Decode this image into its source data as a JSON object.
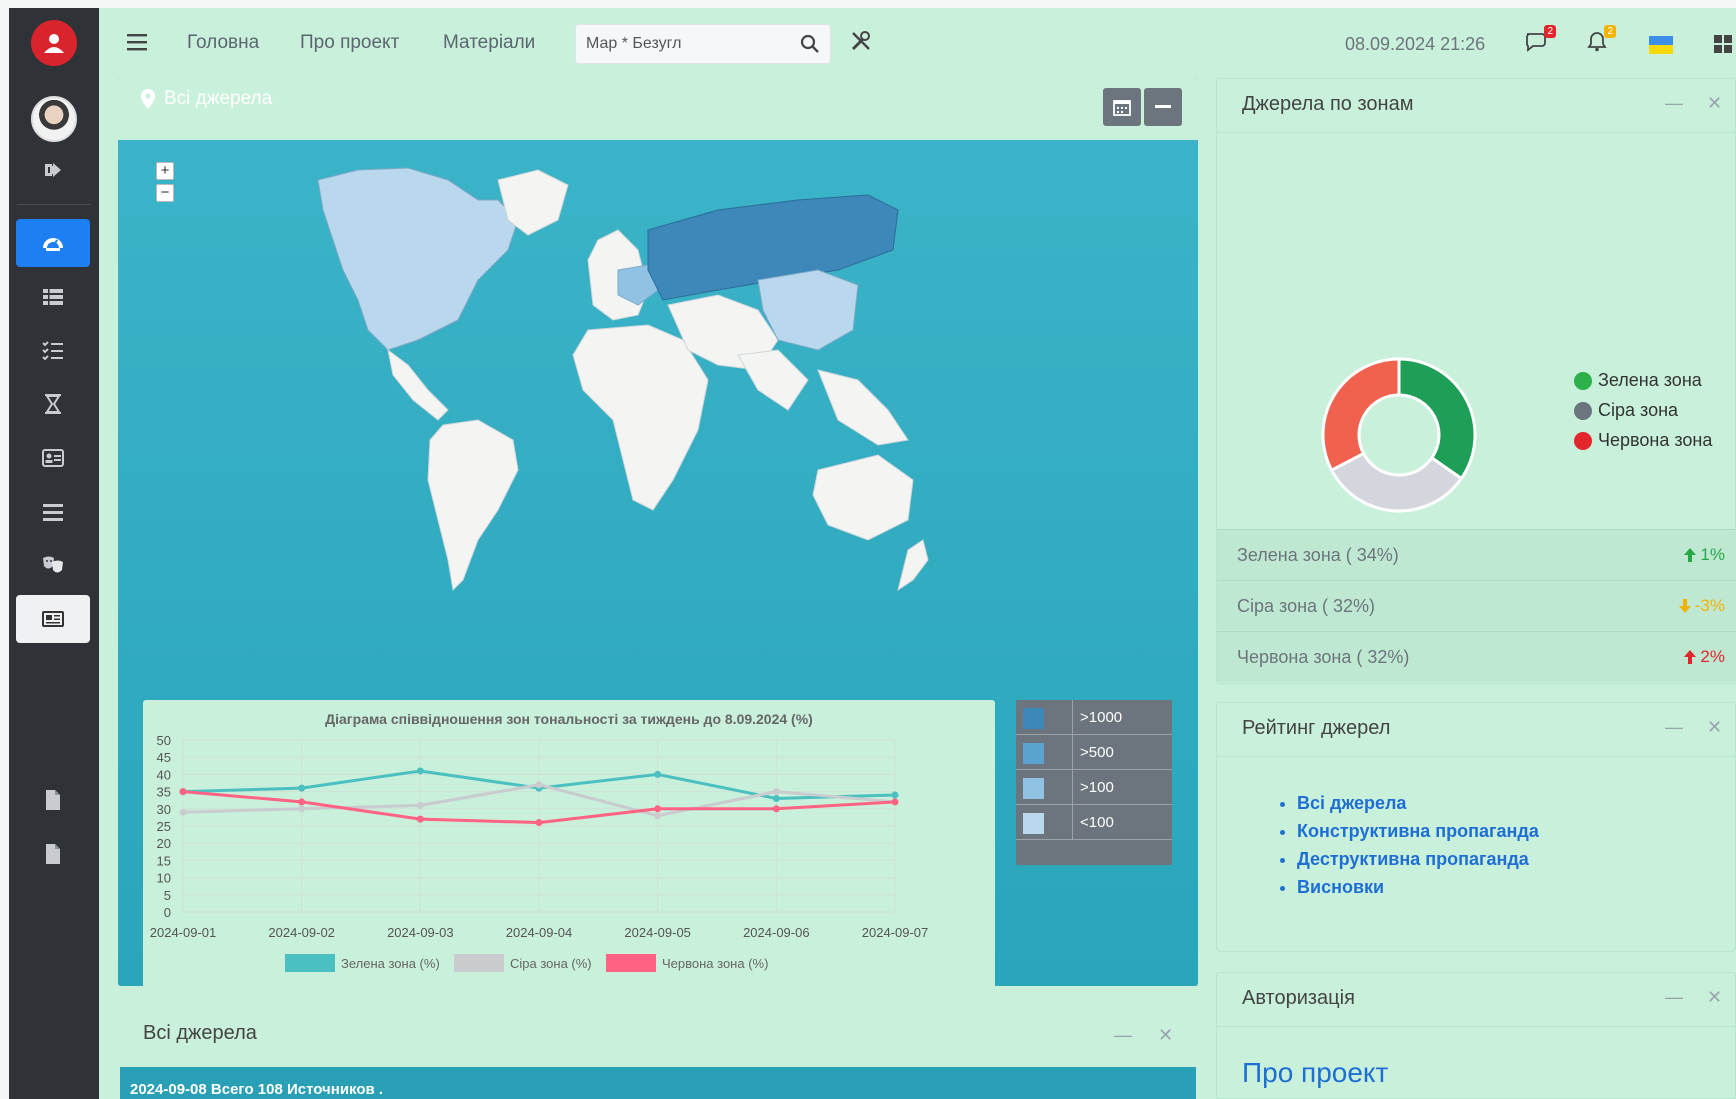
{
  "nav": {
    "links": [
      "Головна",
      "Про проект",
      "Матеріали"
    ],
    "search_value": "Мар * Безугл",
    "datetime": "08.09.2024 21:26",
    "messages_badge": "2",
    "notifications_badge": "2"
  },
  "map_card": {
    "title": "Всі джерела",
    "zoom_in": "+",
    "zoom_out": "−",
    "legend": [
      {
        "label": ">1000",
        "color": "#3d88b9"
      },
      {
        "label": ">500",
        "color": "#5aa3d1"
      },
      {
        "label": ">100",
        "color": "#8fc2e3"
      },
      {
        "label": "<100",
        "color": "#b9d8ee"
      }
    ]
  },
  "chart_data": {
    "type": "line",
    "title": "Діаграма співвідношення зон тональності за тиждень до 8.09.2024 (%)",
    "categories": [
      "2024-09-01",
      "2024-09-02",
      "2024-09-03",
      "2024-09-04",
      "2024-09-05",
      "2024-09-06",
      "2024-09-07"
    ],
    "ylim": [
      0,
      50
    ],
    "yticks": [
      0,
      5,
      10,
      15,
      20,
      25,
      30,
      35,
      40,
      45,
      50
    ],
    "series": [
      {
        "name": "Зелена зона (%)",
        "color": "#4bc0c0",
        "values": [
          35,
          36,
          41,
          36,
          40,
          33,
          34
        ]
      },
      {
        "name": "Сіра зона (%)",
        "color": "#c9cbcf",
        "values": [
          29,
          30,
          31,
          37,
          28,
          35,
          32
        ]
      },
      {
        "name": "Червона зона (%)",
        "color": "#ff6384",
        "values": [
          35,
          32,
          27,
          26,
          30,
          30,
          32
        ]
      }
    ]
  },
  "bottom_card": {
    "title": "Всі джерела",
    "bar_text": "2024-09-08 Всего 108 Источников ."
  },
  "zones_card": {
    "title": "Джерела по зонам",
    "donut": [
      {
        "name": "Зелена зона",
        "value": 34,
        "color": "#1e9e57"
      },
      {
        "name": "Сіра зона",
        "value": 32,
        "color": "#d3d6dc"
      },
      {
        "name": "Червона зона",
        "value": 32,
        "color": "#f0624d"
      }
    ],
    "legend": [
      {
        "label": "Зелена зона",
        "color": "#2db04a"
      },
      {
        "label": "Сіра зона",
        "color": "#6c757d"
      },
      {
        "label": "Червона зона",
        "color": "#e3262b"
      }
    ],
    "rows": [
      {
        "label": "Зелена зона ( 34%)",
        "change": "1%",
        "dir": "up",
        "color": "#28a745"
      },
      {
        "label": "Сіра зона ( 32%)",
        "change": "-3%",
        "dir": "down",
        "color": "#f0b400"
      },
      {
        "label": "Червона зона ( 32%)",
        "change": "2%",
        "dir": "up",
        "color": "#e3262b"
      }
    ]
  },
  "rating_card": {
    "title": "Рейтинг джерел",
    "links": [
      "Всі джерела",
      "Конструктивна пропаганда",
      "Деструктивна пропаганда",
      "Висновки"
    ]
  },
  "auth_card": {
    "title": "Авторизація",
    "link": "Про проект"
  },
  "controls": {
    "minimize": "—",
    "close": "✕"
  }
}
